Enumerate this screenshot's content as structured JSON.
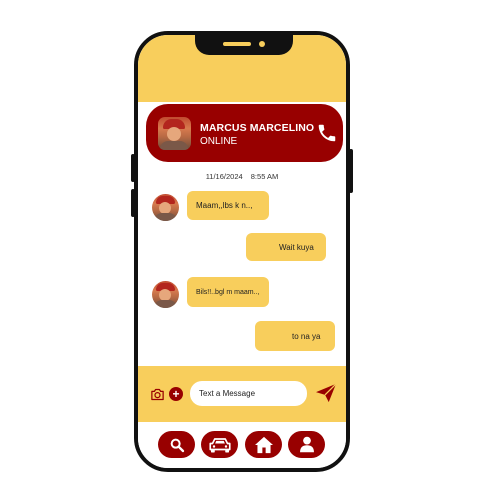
{
  "colors": {
    "accent": "#f8ce5c",
    "brand": "#980000",
    "frame": "#111111"
  },
  "contact": {
    "name": "MARCUS MARCELINO",
    "status": "ONLINE",
    "avatar": "profile-photo",
    "call_icon": "phone-icon"
  },
  "timestamp": {
    "date": "11/16/2024",
    "time": "8:55 AM"
  },
  "messages": [
    {
      "from": "contact",
      "text": "Maam,,lbs k n..,"
    },
    {
      "from": "me",
      "text": "Wait kuya"
    },
    {
      "from": "contact",
      "text": "Bils!!..bgl m maam..,"
    },
    {
      "from": "me",
      "text": "to na ya"
    }
  ],
  "composer": {
    "placeholder": "Text a Message",
    "value": "",
    "camera_icon": "camera-icon",
    "add_icon": "plus-icon",
    "send_icon": "send-icon"
  },
  "nav": [
    {
      "icon": "search-icon"
    },
    {
      "icon": "car-icon"
    },
    {
      "icon": "home-icon"
    },
    {
      "icon": "user-icon"
    }
  ]
}
